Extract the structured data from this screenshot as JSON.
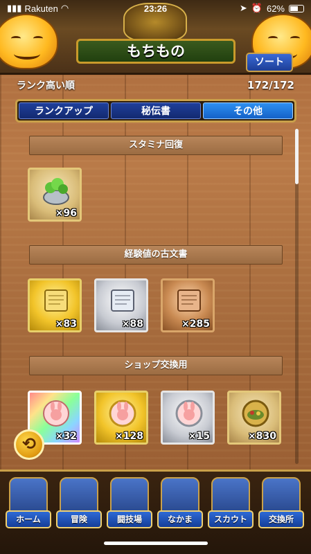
{
  "status": {
    "carrier": "Rakuten",
    "time": "23:26",
    "battery": "62%"
  },
  "header": {
    "title": "もちもの",
    "sort_label": "ソート"
  },
  "subbar": {
    "sort_order": "ランク高い順",
    "count": "172/172"
  },
  "tabs": [
    {
      "label": "ランクアップ",
      "active": false
    },
    {
      "label": "秘伝書",
      "active": false
    },
    {
      "label": "その他",
      "active": true
    }
  ],
  "sections": [
    {
      "title": "スタミナ回復",
      "items": [
        {
          "icon": "herb-bag-icon",
          "qty": "×96",
          "frame": "plain"
        }
      ]
    },
    {
      "title": "経験値の古文書",
      "items": [
        {
          "icon": "gold-scroll-icon",
          "qty": "×83",
          "frame": "gold"
        },
        {
          "icon": "silver-scroll-icon",
          "qty": "×88",
          "frame": "silver"
        },
        {
          "icon": "bronze-scroll-icon",
          "qty": "×285",
          "frame": "bronze"
        }
      ]
    },
    {
      "title": "ショップ交換用",
      "items": [
        {
          "icon": "rainbow-medal-icon",
          "qty": "×32",
          "frame": "rainbow"
        },
        {
          "icon": "gold-medal-icon",
          "qty": "×128",
          "frame": "gold"
        },
        {
          "icon": "silver-medal-icon",
          "qty": "×15",
          "frame": "silver"
        },
        {
          "icon": "food-medal-icon",
          "qty": "×830",
          "frame": "plain"
        }
      ]
    }
  ],
  "nav": [
    {
      "label": "ホーム",
      "icon": "tent-icon"
    },
    {
      "label": "冒険",
      "icon": "carriage-icon"
    },
    {
      "label": "闘技場",
      "icon": "arena-icon"
    },
    {
      "label": "なかま",
      "icon": "monster-icon"
    },
    {
      "label": "スカウト",
      "icon": "portal-icon"
    },
    {
      "label": "交換所",
      "icon": "merchant-icon"
    }
  ]
}
